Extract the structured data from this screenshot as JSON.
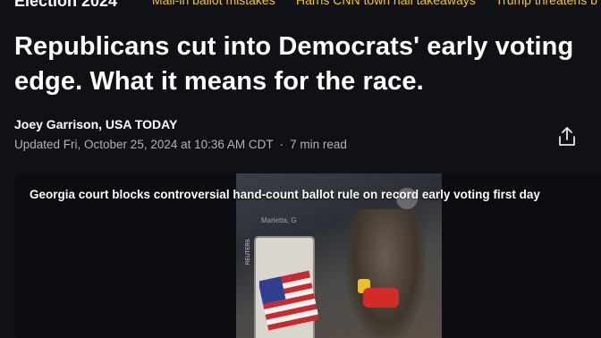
{
  "topnav": {
    "section": "Election 2024",
    "links": [
      "Mail-in ballot mistakes",
      "Harris CNN town hall takeaways",
      "Trump threatens b"
    ]
  },
  "article": {
    "headline": "Republicans cut into Democrats' early voting edge. What it means for the race.",
    "byline": "Joey Garrison, USA TODAY",
    "updated": "Updated Fri, October 25, 2024 at 10:36 AM CDT",
    "separator": "·",
    "read_time": "7 min read"
  },
  "video": {
    "title": "Georgia court blocks controversial hand-count ballot rule on record early voting first day",
    "scene_label": "Marietta, G",
    "credit": "REUTERS"
  },
  "icons": {
    "share": "share-icon"
  },
  "colors": {
    "background": "#101114",
    "nav_link": "#f5c518",
    "meta_text": "#b0b2b8"
  }
}
